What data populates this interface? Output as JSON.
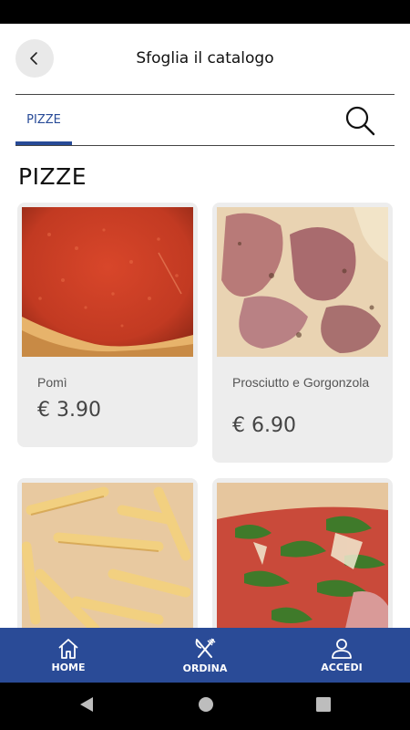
{
  "header": {
    "title": "Sfoglia il catalogo"
  },
  "tabs": [
    {
      "label": "PIZZE",
      "active": true
    }
  ],
  "section": {
    "title": "PIZZE"
  },
  "products": [
    {
      "name": "Pomì",
      "price": "€ 3.90"
    },
    {
      "name": "Prosciutto e Gorgonzola",
      "price": "€ 6.90"
    },
    {
      "name": "",
      "price": ""
    },
    {
      "name": "",
      "price": ""
    }
  ],
  "bottom_nav": {
    "items": [
      {
        "label": "HOME",
        "icon": "home-icon"
      },
      {
        "label": "ORDINA",
        "icon": "fork-knife-icon"
      },
      {
        "label": "ACCEDI",
        "icon": "user-icon"
      }
    ]
  },
  "colors": {
    "accent": "#274a97",
    "nav_bg": "#2a4b97",
    "card_bg": "#ededed"
  }
}
